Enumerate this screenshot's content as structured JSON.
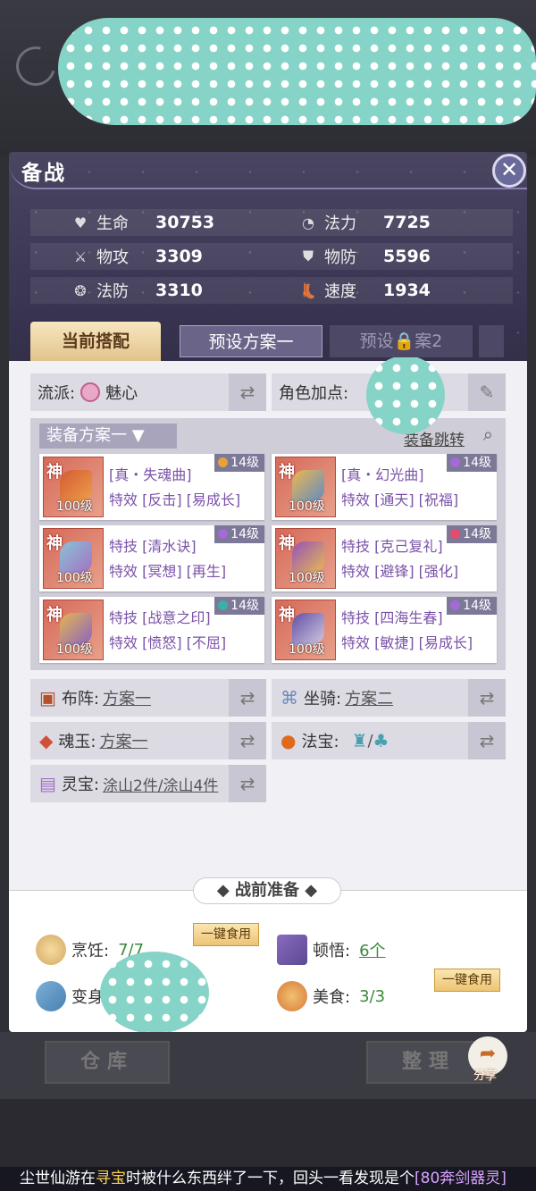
{
  "title": "备战",
  "close_label": "✕",
  "stats": [
    {
      "icon": "heart-icon",
      "glyph": "♥",
      "label": "生命",
      "value": "30753"
    },
    {
      "icon": "mana-swirl-icon",
      "glyph": "◔",
      "label": "法力",
      "value": "7725"
    },
    {
      "icon": "sword-icon",
      "glyph": "⚔",
      "label": "物攻",
      "value": "3309"
    },
    {
      "icon": "shield-icon",
      "glyph": "⛊",
      "label": "物防",
      "value": "5596"
    },
    {
      "icon": "magic-shield-icon",
      "glyph": "❂",
      "label": "法防",
      "value": "3310"
    },
    {
      "icon": "boot-icon",
      "glyph": "👢",
      "label": "速度",
      "value": "1934"
    }
  ],
  "tabs": [
    "当前搭配",
    "预设方案一",
    "预设🔒案2",
    ""
  ],
  "school": {
    "label": "流派:",
    "value": "魅心"
  },
  "attr": {
    "label": "角色加点:"
  },
  "equip": {
    "select": "装备方案一",
    "jump": "装备跳转",
    "items": [
      {
        "shen": "神",
        "level": "100级",
        "badge": "14级",
        "gc": "#e8a03a",
        "line1": "[真・失魂曲]",
        "line2": "特效 [反击] [易成长]",
        "col1": "#d2562a",
        "col2": "#f0a040"
      },
      {
        "shen": "神",
        "level": "100级",
        "badge": "14级",
        "gc": "#a46ad8",
        "line1": "[真・幻光曲]",
        "line2": "特效 [通天] [祝福]",
        "col1": "#f0c24a",
        "col2": "#4a8ad0"
      },
      {
        "shen": "神",
        "level": "100级",
        "badge": "14级",
        "gc": "#a46ad8",
        "line1": "特技 [清水诀]",
        "line2": "特效 [冥想] [再生]",
        "col1": "#7ad0e8",
        "col2": "#9a6ad0"
      },
      {
        "shen": "神",
        "level": "100级",
        "badge": "14级",
        "gc": "#e84a6a",
        "line1": "特技 [克己复礼]",
        "line2": "特效 [避锋] [强化]",
        "col1": "#8a4ac8",
        "col2": "#e8c04a"
      },
      {
        "shen": "神",
        "level": "100级",
        "badge": "14级",
        "gc": "#3ab0a8",
        "line1": "特技 [战意之印]",
        "line2": "特效 [愤怒] [不屈]",
        "col1": "#e8c04a",
        "col2": "#7a5ad0"
      },
      {
        "shen": "神",
        "level": "100级",
        "badge": "14级",
        "gc": "#a46ad8",
        "line1": "特技 [四海生春]",
        "line2": "特效 [敏捷] [易成长]",
        "col1": "#4a4ab0",
        "col2": "#d0d0f0"
      }
    ]
  },
  "extras": [
    {
      "name": "formation",
      "icon": "book-icon",
      "label": "布阵:",
      "value": "方案一"
    },
    {
      "name": "mount",
      "icon": "scroll-icon",
      "label": "坐骑:",
      "value": "方案二"
    },
    {
      "name": "soul-jade",
      "icon": "jade-icon",
      "label": "魂玉:",
      "value": "方案一"
    },
    {
      "name": "magic-treasure",
      "icon": "fire-orb-icon",
      "label": "法宝:",
      "value": "/"
    },
    {
      "name": "spirit-treasure",
      "icon": "chest-icon",
      "label": "灵宝:",
      "value": "涂山2件/涂山4件"
    }
  ],
  "prep": {
    "title": "◆ 战前准备 ◆",
    "cooking": {
      "label": "烹饪:",
      "value": "7/7",
      "button": "一键食用"
    },
    "insight": {
      "label": "顿悟:",
      "value": "6个"
    },
    "transform": {
      "label": "变身:"
    },
    "food": {
      "label": "美食:",
      "value": "3/3",
      "button": "一键食用"
    }
  },
  "bottom": {
    "warehouse": "仓库",
    "organize": "整理",
    "share": "分享"
  },
  "marquee": {
    "a": "尘世仙游在",
    "b": "寻宝",
    "c": "时被什么东西绊了一下，回头一看发现是个",
    "d": "[80奔剑器灵]"
  },
  "colors": {
    "accent": "#7a52a8",
    "panel_header": "#3b3755",
    "tab_active": "#e2c48c"
  }
}
